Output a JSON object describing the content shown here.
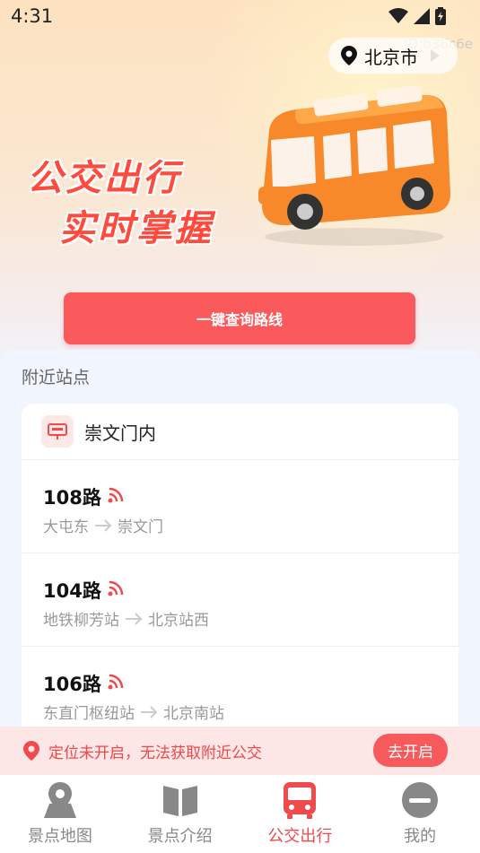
{
  "status": {
    "time": "4:31"
  },
  "watermark": "ID:b36c6e",
  "header": {
    "city": "北京市"
  },
  "banner": {
    "line1": "公交出行",
    "line2": "实时掌握"
  },
  "cta": {
    "label": "一键查询路线"
  },
  "nearby": {
    "title": "附近站点",
    "station": "崇文门内",
    "routes": [
      {
        "name": "108路",
        "from": "大屯东",
        "to": "崇文门"
      },
      {
        "name": "104路",
        "from": "地铁柳芳站",
        "to": "北京站西"
      },
      {
        "name": "106路",
        "from": "东直门枢纽站",
        "to": "北京南站"
      }
    ]
  },
  "alert": {
    "text": "定位未开启，无法获取附近公交",
    "button": "去开启"
  },
  "tabs": [
    {
      "label": "景点地图",
      "icon": "map-pin-icon"
    },
    {
      "label": "景点介绍",
      "icon": "book-icon"
    },
    {
      "label": "公交出行",
      "icon": "bus-icon",
      "active": true
    },
    {
      "label": "我的",
      "icon": "user-icon"
    }
  ],
  "colors": {
    "accent": "#fb5a5c",
    "active_tab": "#f04a4c",
    "background": "#f0f5fe"
  }
}
